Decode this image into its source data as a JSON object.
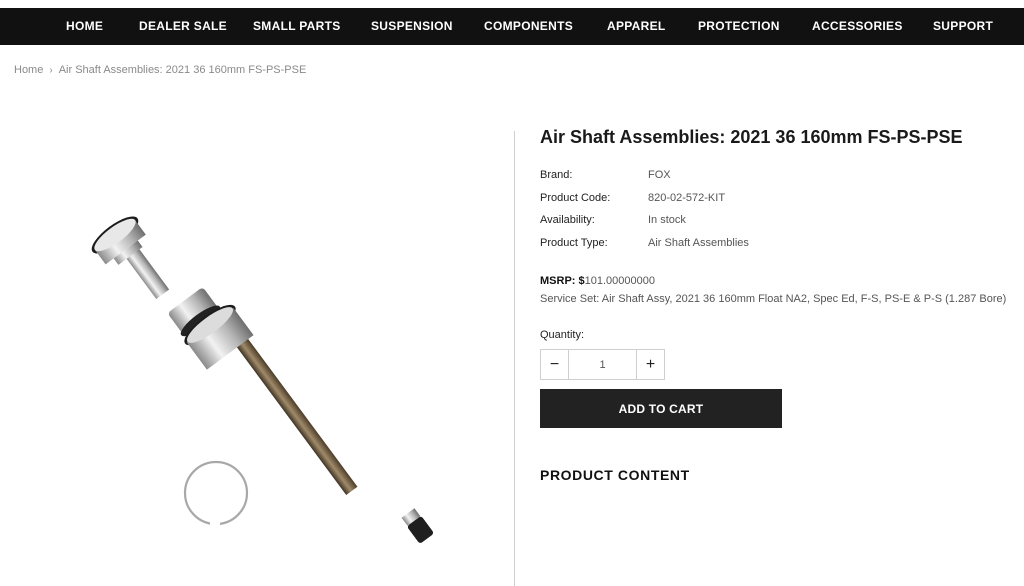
{
  "nav": {
    "items": [
      "HOME",
      "DEALER SALE",
      "SMALL PARTS",
      "SUSPENSION",
      "COMPONENTS",
      "APPAREL",
      "PROTECTION",
      "ACCESSORIES",
      "SUPPORT"
    ]
  },
  "breadcrumb": {
    "home": "Home",
    "current": "Air Shaft Assemblies: 2021 36 160mm FS-PS-PSE"
  },
  "product": {
    "title": "Air Shaft Assemblies: 2021 36 160mm FS-PS-PSE",
    "specs": [
      {
        "label": "Brand:",
        "value": "FOX"
      },
      {
        "label": "Product Code:",
        "value": "820-02-572-KIT"
      },
      {
        "label": "Availability:",
        "value": "In stock"
      },
      {
        "label": "Product Type:",
        "value": "Air Shaft Assemblies"
      }
    ],
    "msrp_label": "MSRP: $",
    "msrp_value": "101.00000000",
    "service_set": "Service Set: Air Shaft Assy, 2021 36 160mm Float NA2, Spec Ed, F-S, PS-E & P-S (1.287 Bore)"
  },
  "quantity": {
    "label": "Quantity:",
    "value": "1",
    "minus": "−",
    "plus": "+"
  },
  "add_to_cart": "ADD TO CART",
  "product_content_heading": "PRODUCT CONTENT"
}
